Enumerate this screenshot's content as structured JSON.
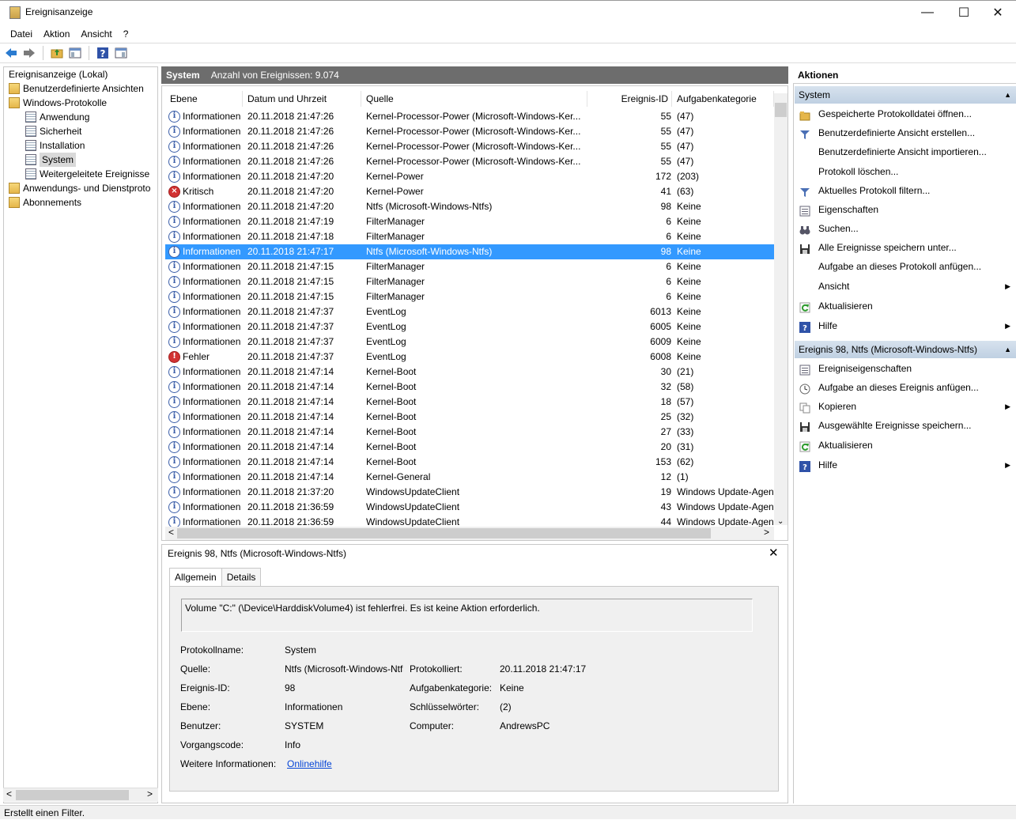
{
  "window": {
    "title": "Ereignisanzeige",
    "minimize": "—",
    "maximize": "☐",
    "close": "✕"
  },
  "menu": [
    "Datei",
    "Aktion",
    "Ansicht",
    "?"
  ],
  "toolbar_icons": [
    "back-arrow-icon",
    "forward-arrow-icon",
    "folder-up-icon",
    "show-hide-tree-icon",
    "help-icon",
    "show-hide-action-pane-icon"
  ],
  "tree": {
    "root": "Ereignisanzeige (Lokal)",
    "custom_views": "Benutzerdefinierte Ansichten",
    "windows_logs": "Windows-Protokolle",
    "logs": [
      "Anwendung",
      "Sicherheit",
      "Installation",
      "System",
      "Weitergeleitete Ereignisse"
    ],
    "app_service_logs": "Anwendungs- und Dienstproto",
    "subscriptions": "Abonnements"
  },
  "center": {
    "title": "System",
    "count_text": "Anzahl von Ereignissen: 9.074"
  },
  "columns": [
    "Ebene",
    "Datum und Uhrzeit",
    "Quelle",
    "Ereignis-ID",
    "Aufgabenkategorie"
  ],
  "rows": [
    {
      "level": "Informationen",
      "type": "info",
      "date": "20.11.2018 21:47:26",
      "source": "Kernel-Processor-Power (Microsoft-Windows-Ker...",
      "id": "55",
      "cat": "(47)"
    },
    {
      "level": "Informationen",
      "type": "info",
      "date": "20.11.2018 21:47:26",
      "source": "Kernel-Processor-Power (Microsoft-Windows-Ker...",
      "id": "55",
      "cat": "(47)"
    },
    {
      "level": "Informationen",
      "type": "info",
      "date": "20.11.2018 21:47:26",
      "source": "Kernel-Processor-Power (Microsoft-Windows-Ker...",
      "id": "55",
      "cat": "(47)"
    },
    {
      "level": "Informationen",
      "type": "info",
      "date": "20.11.2018 21:47:26",
      "source": "Kernel-Processor-Power (Microsoft-Windows-Ker...",
      "id": "55",
      "cat": "(47)"
    },
    {
      "level": "Informationen",
      "type": "info",
      "date": "20.11.2018 21:47:20",
      "source": "Kernel-Power",
      "id": "172",
      "cat": "(203)"
    },
    {
      "level": "Kritisch",
      "type": "crit",
      "date": "20.11.2018 21:47:20",
      "source": "Kernel-Power",
      "id": "41",
      "cat": "(63)"
    },
    {
      "level": "Informationen",
      "type": "info",
      "date": "20.11.2018 21:47:20",
      "source": "Ntfs (Microsoft-Windows-Ntfs)",
      "id": "98",
      "cat": "Keine"
    },
    {
      "level": "Informationen",
      "type": "info",
      "date": "20.11.2018 21:47:19",
      "source": "FilterManager",
      "id": "6",
      "cat": "Keine"
    },
    {
      "level": "Informationen",
      "type": "info",
      "date": "20.11.2018 21:47:18",
      "source": "FilterManager",
      "id": "6",
      "cat": "Keine"
    },
    {
      "level": "Informationen",
      "type": "info",
      "date": "20.11.2018 21:47:17",
      "source": "Ntfs (Microsoft-Windows-Ntfs)",
      "id": "98",
      "cat": "Keine",
      "selected": true
    },
    {
      "level": "Informationen",
      "type": "info",
      "date": "20.11.2018 21:47:15",
      "source": "FilterManager",
      "id": "6",
      "cat": "Keine"
    },
    {
      "level": "Informationen",
      "type": "info",
      "date": "20.11.2018 21:47:15",
      "source": "FilterManager",
      "id": "6",
      "cat": "Keine"
    },
    {
      "level": "Informationen",
      "type": "info",
      "date": "20.11.2018 21:47:15",
      "source": "FilterManager",
      "id": "6",
      "cat": "Keine"
    },
    {
      "level": "Informationen",
      "type": "info",
      "date": "20.11.2018 21:47:37",
      "source": "EventLog",
      "id": "6013",
      "cat": "Keine"
    },
    {
      "level": "Informationen",
      "type": "info",
      "date": "20.11.2018 21:47:37",
      "source": "EventLog",
      "id": "6005",
      "cat": "Keine"
    },
    {
      "level": "Informationen",
      "type": "info",
      "date": "20.11.2018 21:47:37",
      "source": "EventLog",
      "id": "6009",
      "cat": "Keine"
    },
    {
      "level": "Fehler",
      "type": "err",
      "date": "20.11.2018 21:47:37",
      "source": "EventLog",
      "id": "6008",
      "cat": "Keine"
    },
    {
      "level": "Informationen",
      "type": "info",
      "date": "20.11.2018 21:47:14",
      "source": "Kernel-Boot",
      "id": "30",
      "cat": "(21)"
    },
    {
      "level": "Informationen",
      "type": "info",
      "date": "20.11.2018 21:47:14",
      "source": "Kernel-Boot",
      "id": "32",
      "cat": "(58)"
    },
    {
      "level": "Informationen",
      "type": "info",
      "date": "20.11.2018 21:47:14",
      "source": "Kernel-Boot",
      "id": "18",
      "cat": "(57)"
    },
    {
      "level": "Informationen",
      "type": "info",
      "date": "20.11.2018 21:47:14",
      "source": "Kernel-Boot",
      "id": "25",
      "cat": "(32)"
    },
    {
      "level": "Informationen",
      "type": "info",
      "date": "20.11.2018 21:47:14",
      "source": "Kernel-Boot",
      "id": "27",
      "cat": "(33)"
    },
    {
      "level": "Informationen",
      "type": "info",
      "date": "20.11.2018 21:47:14",
      "source": "Kernel-Boot",
      "id": "20",
      "cat": "(31)"
    },
    {
      "level": "Informationen",
      "type": "info",
      "date": "20.11.2018 21:47:14",
      "source": "Kernel-Boot",
      "id": "153",
      "cat": "(62)"
    },
    {
      "level": "Informationen",
      "type": "info",
      "date": "20.11.2018 21:47:14",
      "source": "Kernel-General",
      "id": "12",
      "cat": "(1)"
    },
    {
      "level": "Informationen",
      "type": "info",
      "date": "20.11.2018 21:37:20",
      "source": "WindowsUpdateClient",
      "id": "19",
      "cat": "Windows Update-Agent"
    },
    {
      "level": "Informationen",
      "type": "info",
      "date": "20.11.2018 21:36:59",
      "source": "WindowsUpdateClient",
      "id": "43",
      "cat": "Windows Update-Agent"
    },
    {
      "level": "Informationen",
      "type": "info",
      "date": "20.11.2018 21:36:59",
      "source": "WindowsUpdateClient",
      "id": "44",
      "cat": "Windows Update-Agent"
    }
  ],
  "detail": {
    "title": "Ereignis 98, Ntfs (Microsoft-Windows-Ntfs)",
    "tabs": [
      "Allgemein",
      "Details"
    ],
    "message": "Volume \"C:\" (\\Device\\HarddiskVolume4) ist fehlerfrei. Es ist keine Aktion erforderlich.",
    "labels": {
      "log": "Protokollname:",
      "source": "Quelle:",
      "event_id": "Ereignis-ID:",
      "level": "Ebene:",
      "user": "Benutzer:",
      "opcode": "Vorgangscode:",
      "more": "Weitere Informationen:",
      "logged": "Protokolliert:",
      "task": "Aufgabenkategorie:",
      "keywords": "Schlüsselwörter:",
      "computer": "Computer:"
    },
    "values": {
      "log": "System",
      "source": "Ntfs (Microsoft-Windows-Ntfs)",
      "event_id": "98",
      "level": "Informationen",
      "user": "SYSTEM",
      "opcode": "Info",
      "more": "Onlinehilfe",
      "logged": "20.11.2018 21:47:17",
      "task": "Keine",
      "keywords": "(2)",
      "computer": "AndrewsPC"
    }
  },
  "actions": {
    "title": "Aktionen",
    "section1": "System",
    "items1": [
      {
        "label": "Gespeicherte Protokolldatei öffnen...",
        "icon": "open-folder-icon"
      },
      {
        "label": "Benutzerdefinierte Ansicht erstellen...",
        "icon": "filter-icon"
      },
      {
        "label": "Benutzerdefinierte Ansicht importieren...",
        "icon": ""
      },
      {
        "label": "Protokoll löschen...",
        "icon": ""
      },
      {
        "label": "Aktuelles Protokoll filtern...",
        "icon": "filter-icon"
      },
      {
        "label": "Eigenschaften",
        "icon": "properties-icon"
      },
      {
        "label": "Suchen...",
        "icon": "binoculars-icon"
      },
      {
        "label": "Alle Ereignisse speichern unter...",
        "icon": "save-icon"
      },
      {
        "label": "Aufgabe an dieses Protokoll anfügen...",
        "icon": ""
      },
      {
        "label": "Ansicht",
        "icon": "",
        "submenu": true
      },
      {
        "label": "Aktualisieren",
        "icon": "refresh-icon"
      },
      {
        "label": "Hilfe",
        "icon": "help-icon",
        "submenu": true
      }
    ],
    "section2": "Ereignis 98, Ntfs (Microsoft-Windows-Ntfs)",
    "items2": [
      {
        "label": "Ereigniseigenschaften",
        "icon": "properties-icon"
      },
      {
        "label": "Aufgabe an dieses Ereignis anfügen...",
        "icon": "task-clock-icon"
      },
      {
        "label": "Kopieren",
        "icon": "copy-icon",
        "submenu": true
      },
      {
        "label": "Ausgewählte Ereignisse speichern...",
        "icon": "save-icon"
      },
      {
        "label": "Aktualisieren",
        "icon": "refresh-icon"
      },
      {
        "label": "Hilfe",
        "icon": "help-icon",
        "submenu": true
      }
    ]
  },
  "status": "Erstellt einen Filter."
}
